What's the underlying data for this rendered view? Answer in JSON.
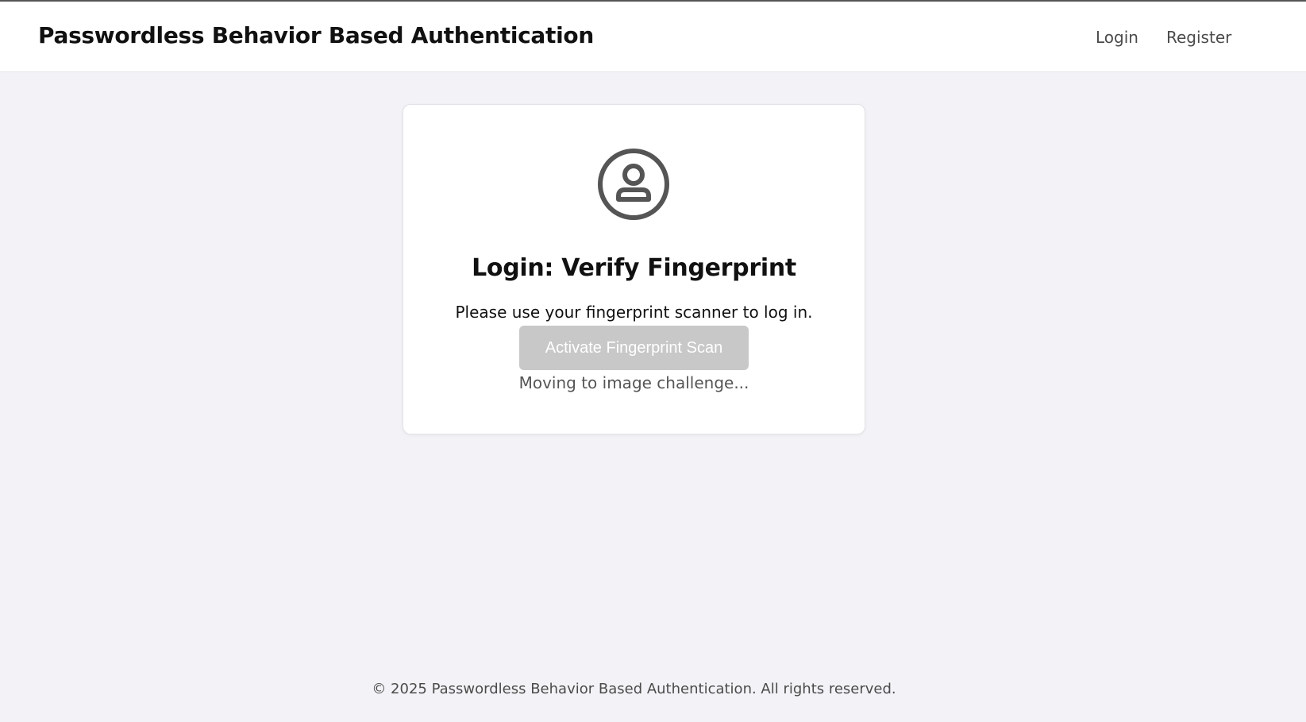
{
  "header": {
    "title": "Passwordless Behavior Based Authentication",
    "nav": {
      "login": "Login",
      "register": "Register"
    }
  },
  "card": {
    "icon": "user-circle-icon",
    "title": "Login: Verify Fingerprint",
    "description": "Please use your fingerprint scanner to log in.",
    "button_label": "Activate Fingerprint Scan",
    "status": "Moving to image challenge..."
  },
  "footer": {
    "copyright": "© 2025 Passwordless Behavior Based Authentication. All rights reserved."
  },
  "colors": {
    "background": "#f3f3f7",
    "header_bg": "#ffffff",
    "button_disabled": "#c8c8c8",
    "icon": "#555555"
  }
}
